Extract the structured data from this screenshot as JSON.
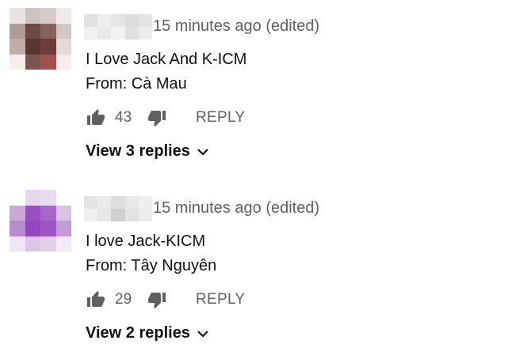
{
  "colors": {
    "text_primary": "#111111",
    "text_secondary": "#606060",
    "icon": "#606060"
  },
  "comments": [
    {
      "timestamp": "15 minutes ago (edited)",
      "lines": [
        "I Love Jack And K-ICM",
        "From: Cà Mau"
      ],
      "likes": "43",
      "like_icon": "thumb-up-icon",
      "dislike_icon": "thumb-down-icon",
      "reply_label": "REPLY",
      "view_replies_label": "View 3 replies",
      "chevron_icon": "chevron-down-icon"
    },
    {
      "timestamp": "15 minutes ago (edited)",
      "lines": [
        "I love Jack-KICM",
        "From: Tây Nguyên"
      ],
      "likes": "29",
      "like_icon": "thumb-up-icon",
      "dislike_icon": "thumb-down-icon",
      "reply_label": "REPLY",
      "view_replies_label": "View 2 replies",
      "chevron_icon": "chevron-down-icon"
    }
  ]
}
